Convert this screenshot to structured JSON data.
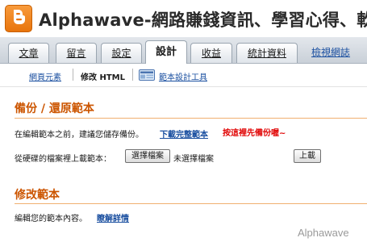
{
  "header": {
    "title": "Alphawave-網路賺錢資訊、學習心得、軟"
  },
  "tabs": [
    {
      "label": "文章",
      "active": false
    },
    {
      "label": "留言",
      "active": false
    },
    {
      "label": "設定",
      "active": false
    },
    {
      "label": "設計",
      "active": true
    },
    {
      "label": "收益",
      "active": false
    },
    {
      "label": "統計資料",
      "active": false
    }
  ],
  "view_blog_link": "檢視網誌",
  "subnav": {
    "page_elements": "網頁元素",
    "edit_html": "修改 HTML",
    "template_designer": "範本設計工具"
  },
  "backup": {
    "heading": "備份 / 還原範本",
    "intro": "在編輯範本之前，建議您儲存備份。",
    "download_link": "下載完整範本",
    "annotation": "按這裡先備份喔~",
    "upload_label": "從硬碟的檔案裡上載範本：",
    "choose_file_button": "選擇檔案",
    "no_file_text": "未選擇檔案",
    "upload_button": "上載"
  },
  "edit": {
    "heading": "修改範本",
    "intro": "編輯您的範本內容。",
    "learn_more_link": "瞭解詳情"
  },
  "watermark": "Alphawave",
  "colors": {
    "accent": "#cc5500",
    "link": "#1a4fa0",
    "annotation": "#e00000"
  }
}
